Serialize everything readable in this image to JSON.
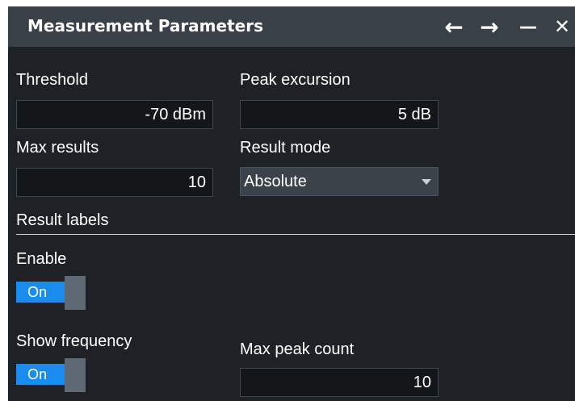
{
  "dialog": {
    "title": "Measurement Parameters",
    "controls": {
      "back_icon": "←",
      "forward_icon": "→",
      "minimize_icon": "—",
      "close_icon": "✕"
    }
  },
  "fields": {
    "threshold": {
      "label": "Threshold",
      "value": "-70 dBm"
    },
    "peak_excursion": {
      "label": "Peak excursion",
      "value": "5 dB"
    },
    "max_results": {
      "label": "Max results",
      "value": "10"
    },
    "result_mode": {
      "label": "Result mode",
      "value": "Absolute"
    }
  },
  "result_labels": {
    "section_title": "Result labels",
    "enable": {
      "label": "Enable",
      "state": "On"
    },
    "show_frequency": {
      "label": "Show frequency",
      "state": "On"
    },
    "max_peak_count": {
      "label": "Max peak count",
      "value": "10"
    }
  },
  "colors": {
    "accent": "#1a8cf0",
    "background": "#1e2226",
    "titlebar": "#3a4047"
  }
}
